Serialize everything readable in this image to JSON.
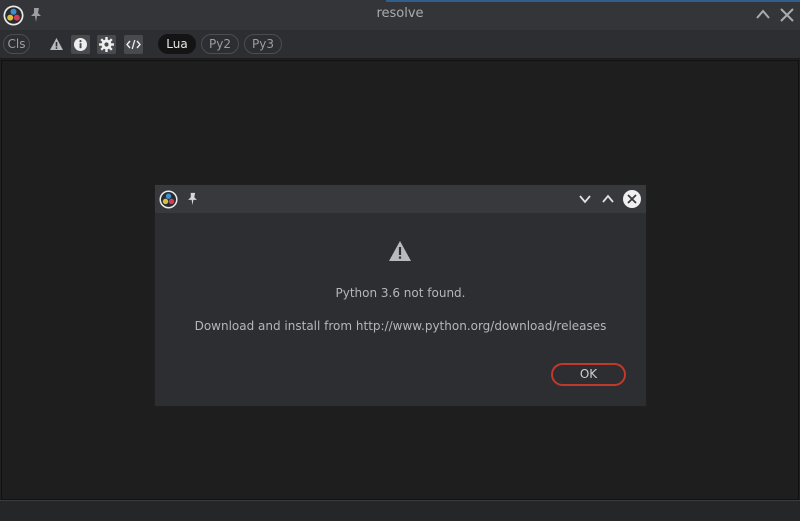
{
  "window": {
    "title": "resolve",
    "icons": [
      "davinci-resolve-logo-icon",
      "pin-icon",
      "chevron-up-icon",
      "close-icon"
    ]
  },
  "toolbar": {
    "clear_label": "Cls",
    "languages": [
      {
        "label": "Lua",
        "active": true
      },
      {
        "label": "Py2",
        "active": false
      },
      {
        "label": "Py3",
        "active": false
      }
    ],
    "icons": [
      "warning-icon",
      "info-icon",
      "gear-icon",
      "code-icon"
    ]
  },
  "dialog": {
    "message": "Python 3.6 not found.",
    "detail": "Download and install from http://www.python.org/download/releases",
    "ok_label": "OK",
    "icons": [
      "davinci-resolve-logo-icon",
      "pin-icon",
      "chevron-down-icon",
      "chevron-up-icon",
      "close-icon",
      "warning-icon"
    ]
  },
  "colors": {
    "accent_border": "#c0392b",
    "title_accent": "#2f5f8c"
  }
}
